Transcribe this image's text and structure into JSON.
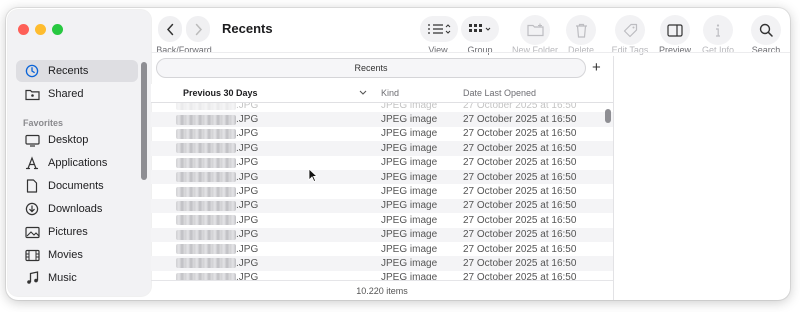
{
  "window": {
    "title": "Recents"
  },
  "toolbar": {
    "back_forward_label": "Back/Forward",
    "view_label": "View",
    "group_label": "Group",
    "new_folder_label": "New Folder",
    "delete_label": "Delete",
    "edit_tags_label": "Edit Tags",
    "preview_label": "Preview",
    "get_info_label": "Get Info",
    "search_label": "Search"
  },
  "sidebar": {
    "top_items": [
      {
        "label": "Recents",
        "icon": "clock-icon",
        "active": true
      },
      {
        "label": "Shared",
        "icon": "shared-folder-icon",
        "active": false
      }
    ],
    "favorites_heading": "Favorites",
    "favorites": [
      {
        "label": "Desktop",
        "icon": "desktop-icon"
      },
      {
        "label": "Applications",
        "icon": "applications-icon"
      },
      {
        "label": "Documents",
        "icon": "document-icon"
      },
      {
        "label": "Downloads",
        "icon": "download-icon"
      },
      {
        "label": "Pictures",
        "icon": "pictures-icon"
      },
      {
        "label": "Movies",
        "icon": "movies-icon"
      },
      {
        "label": "Music",
        "icon": "music-icon"
      }
    ]
  },
  "tab": {
    "label": "Recents"
  },
  "list": {
    "columns": {
      "name": "Previous 30 Days",
      "kind": "Kind",
      "date": "Date Last Opened"
    },
    "rows": [
      {
        "suffix": ".JPG",
        "kind": "JPEG image",
        "date": "27 October 2025 at 16:50"
      },
      {
        "suffix": ".JPG",
        "kind": "JPEG image",
        "date": "27 October 2025 at 16:50"
      },
      {
        "suffix": ".JPG",
        "kind": "JPEG image",
        "date": "27 October 2025 at 16:50"
      },
      {
        "suffix": ".JPG",
        "kind": "JPEG image",
        "date": "27 October 2025 at 16:50"
      },
      {
        "suffix": ".JPG",
        "kind": "JPEG image",
        "date": "27 October 2025 at 16:50"
      },
      {
        "suffix": ".JPG",
        "kind": "JPEG image",
        "date": "27 October 2025 at 16:50"
      },
      {
        "suffix": ".JPG",
        "kind": "JPEG image",
        "date": "27 October 2025 at 16:50"
      },
      {
        "suffix": ".JPG",
        "kind": "JPEG image",
        "date": "27 October 2025 at 16:50"
      },
      {
        "suffix": ".JPG",
        "kind": "JPEG image",
        "date": "27 October 2025 at 16:50"
      },
      {
        "suffix": ".JPG",
        "kind": "JPEG image",
        "date": "27 October 2025 at 16:50"
      },
      {
        "suffix": ".JPG",
        "kind": "JPEG image",
        "date": "27 October 2025 at 16:50"
      },
      {
        "suffix": ".JPG",
        "kind": "JPEG image",
        "date": "27 October 2025 at 16:50"
      },
      {
        "suffix": ".JPG",
        "kind": "JPEG image",
        "date": "27 October 2025 at 16:50"
      },
      {
        "suffix": ".JPG",
        "kind": "JPEG image",
        "date": "27 October 2025 at 16:50"
      }
    ],
    "status": "10.220 items"
  },
  "colors": {
    "accent": "#0a64d8",
    "close": "#fe5f57",
    "minimize": "#febc2e",
    "zoom": "#28c840"
  }
}
